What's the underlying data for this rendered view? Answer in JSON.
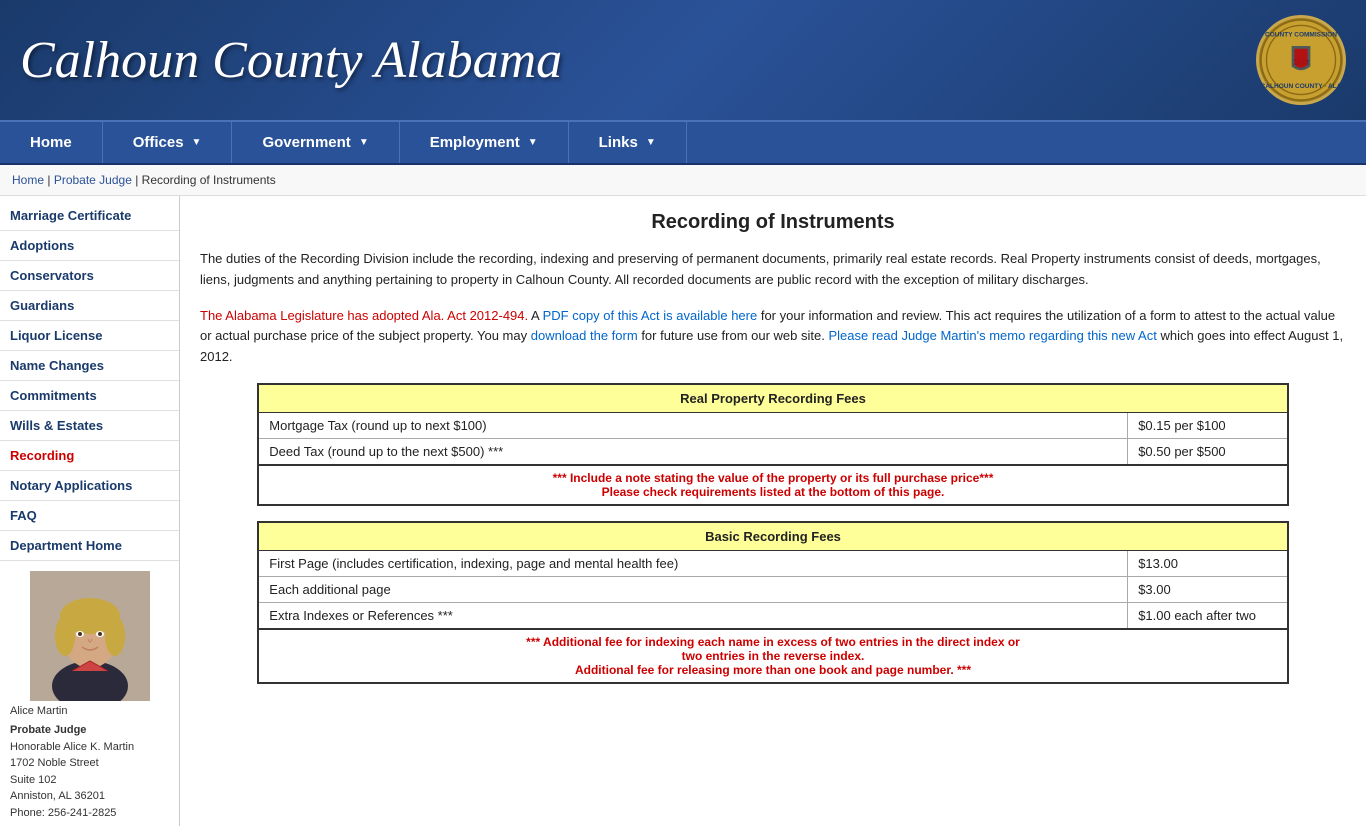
{
  "header": {
    "title": "Calhoun County Alabama",
    "seal_text": "COUNTY COMMISSION"
  },
  "nav": {
    "items": [
      {
        "label": "Home",
        "has_arrow": false
      },
      {
        "label": "Offices",
        "has_arrow": true
      },
      {
        "label": "Government",
        "has_arrow": true
      },
      {
        "label": "Employment",
        "has_arrow": true
      },
      {
        "label": "Links",
        "has_arrow": true
      }
    ]
  },
  "breadcrumb": {
    "home": "Home",
    "separator1": " | ",
    "probate": "Probate Judge",
    "separator2": " | ",
    "current": "Recording of Instruments"
  },
  "sidebar": {
    "items": [
      {
        "label": "Marriage Certificate",
        "active": false
      },
      {
        "label": "Adoptions",
        "active": false
      },
      {
        "label": "Conservators",
        "active": false
      },
      {
        "label": "Guardians",
        "active": false
      },
      {
        "label": "Liquor License",
        "active": false
      },
      {
        "label": "Name Changes",
        "active": false
      },
      {
        "label": "Commitments",
        "active": false
      },
      {
        "label": "Wills & Estates",
        "active": false
      },
      {
        "label": "Recording",
        "active": true
      },
      {
        "label": "Notary Applications",
        "active": false
      },
      {
        "label": "FAQ",
        "active": false
      },
      {
        "label": "Department Home",
        "active": false
      }
    ],
    "photo_caption": "Alice Martin",
    "judge_title": "Probate Judge",
    "judge_name": "Honorable Alice K. Martin",
    "judge_address1": "1702 Noble Street",
    "judge_address2": "Suite 102",
    "judge_address3": "Anniston, AL 36201",
    "judge_phone": "Phone: 256-241-2825"
  },
  "main": {
    "page_title": "Recording of Instruments",
    "intro": "The duties of the Recording Division include the recording, indexing and preserving of permanent documents, primarily real estate records.  Real Property instruments consist of deeds, mortgages, liens, judgments and anything  pertaining to property in Calhoun County.  All recorded documents are public record with the exception of military discharges.",
    "act_text1": "The Alabama Legislature has adopted Ala. Act 2012-494.",
    "act_text2": " A ",
    "act_link1": "PDF copy of this Act is available here",
    "act_text3": " for your information and review. This act requires the utilization of a form to attest to the actual value or actual purchase price of the subject property. You may ",
    "act_link2": "download the form",
    "act_text4": " for future use from our web site. ",
    "act_link3": "Please read Judge Martin's memo regarding this new Act",
    "act_text5": " which goes into effect August 1, 2012.",
    "real_property_table": {
      "header": "Real Property Recording Fees",
      "rows": [
        {
          "description": "Mortgage Tax (round up to next $100)",
          "amount": "$0.15 per $100"
        },
        {
          "description": "Deed Tax (round up to the next $500) ***",
          "amount": "$0.50 per $500"
        }
      ],
      "note_line1": "*** Include a note stating the value of the property or its full purchase price***",
      "note_line2": "Please check requirements listed at the bottom of this page."
    },
    "basic_recording_table": {
      "header": "Basic Recording Fees",
      "rows": [
        {
          "description": "First Page (includes certification, indexing, page and mental health fee)",
          "amount": "$13.00"
        },
        {
          "description": "Each additional page",
          "amount": "$3.00"
        },
        {
          "description": "Extra Indexes or References ***",
          "amount": "$1.00 each after two"
        }
      ],
      "note_line1": "*** Additional fee for indexing each name in excess of two entries in the direct index or",
      "note_line2": "two entries in the reverse index.",
      "note_line3": "Additional fee for releasing more than one book and page number. ***"
    }
  }
}
